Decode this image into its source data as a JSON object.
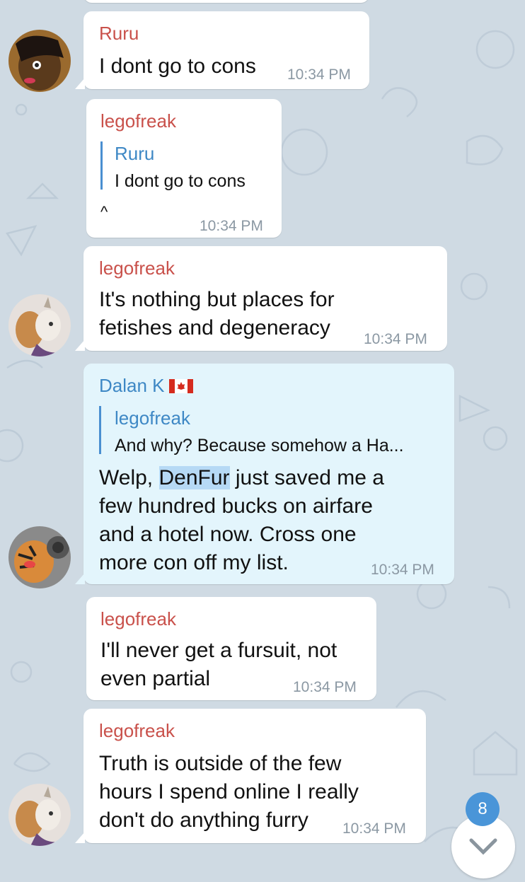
{
  "messages": [
    {
      "sender": "Ruru",
      "text": "I dont go to cons",
      "time": "10:34 PM"
    },
    {
      "sender": "legofreak",
      "reply": {
        "name": "Ruru",
        "text": "I dont go to cons"
      },
      "text": "^",
      "time": "10:34 PM"
    },
    {
      "sender": "legofreak",
      "lines": [
        "It's nothing but places for",
        "fetishes and degeneracy"
      ],
      "time": "10:34 PM"
    },
    {
      "sender": "Dalan K",
      "reply": {
        "name": "legofreak",
        "text": "And why? Because somehow a Ha..."
      },
      "lines": [
        "just saved me a",
        "few hundred bucks on airfare",
        "and a hotel now. Cross one",
        "more con off my list."
      ],
      "highlight": "DenFur",
      "prefix": "Welp,",
      "time": "10:34 PM"
    },
    {
      "sender": "legofreak",
      "lines": [
        "I'll never get a fursuit, not",
        "even partial"
      ],
      "time": "10:34 PM"
    },
    {
      "sender": "legofreak",
      "lines": [
        "Truth is outside of the few",
        "hours I spend online I really",
        "don't do anything furry"
      ],
      "time": "10:34 PM"
    }
  ],
  "unread_badge": "8",
  "colors": {
    "background": "#cfdae3",
    "incoming": "#ffffff",
    "outgoing": "#e3f5fc",
    "sender_red": "#c9514b",
    "sender_blue": "#3e88c5",
    "badge": "#4a95d8"
  }
}
